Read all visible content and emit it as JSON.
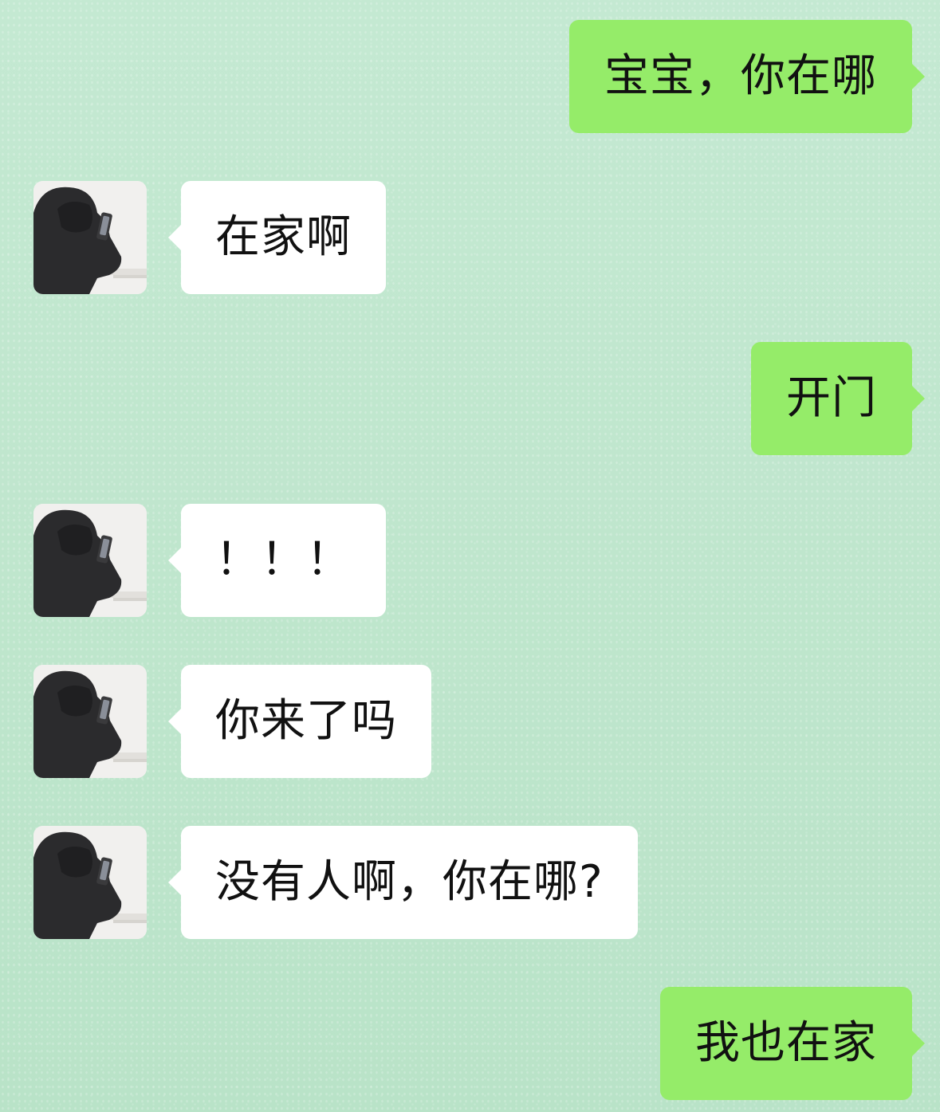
{
  "chat": {
    "messages": [
      {
        "side": "out",
        "text": "宝宝，你在哪"
      },
      {
        "side": "in",
        "text": "在家啊"
      },
      {
        "side": "out",
        "text": "开门"
      },
      {
        "side": "in",
        "text": "！！！"
      },
      {
        "side": "in",
        "text": "你来了吗"
      },
      {
        "side": "in",
        "text": "没有人啊，你在哪?"
      },
      {
        "side": "out",
        "text": "我也在家"
      }
    ],
    "avatar_icon": "avatar-person-on-phone",
    "colors": {
      "background": "#bfe6cd",
      "outgoing_bubble": "#95ec69",
      "incoming_bubble": "#ffffff",
      "text": "#111111"
    }
  }
}
